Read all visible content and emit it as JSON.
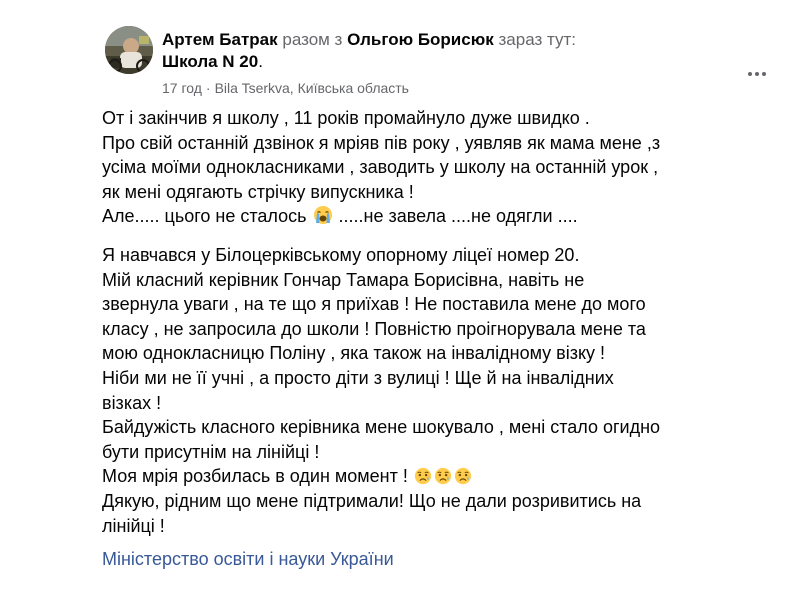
{
  "post": {
    "author": "Артем Батрак",
    "with_text": "разом з",
    "tagged_person": "Ольгою Борисюк",
    "at_text": "зараз тут:",
    "place": "Школа N 20",
    "place_suffix": ".",
    "time": "17 год",
    "location": "Bila Tserkva, Київська область",
    "paragraph_1": [
      "От і закінчив я школу , 11 років промайнуло дуже швидко .",
      "Про свій останній дзвінок я мріяв пів року , уявляв як мама мене ,з",
      "усіма моїми однокласниками , заводить у школу на останній урок ,",
      "як мені одягають стрічку випускника !"
    ],
    "paragraph_1_last_before": "Але..... цього не сталось",
    "paragraph_1_last_after": ".....не завела ....не одягли ....",
    "paragraph_2": [
      "Я навчався у Білоцерківському опорному ліцеї номер 20.",
      "Мій класний керівник Гончар Тамара Борисівна, навіть не",
      "звернула уваги , на те що я приїхав ! Не поставила мене до мого",
      "класу , не запросила до школи ! Повністю проігнорувала мене та",
      "мою однокласницю Поліну , яка також на інвалідному візку !",
      "Ніби ми не її учні , а просто діти з вулиці ! Ще й на інвалідних",
      "візках !",
      "Байдужість класного керівника мене шокувало , мені стало огидно",
      "бути присутнім на лінійці !"
    ],
    "dream_line": "Моя мрія розбилась в один момент !",
    "thanks_lines": [
      "Дякую, рідним що мене підтримали! Що не дали розривитись на",
      "лінійці !"
    ],
    "page_link": "Міністерство освіти і науки України"
  },
  "icons": {
    "crying": "loudly-crying-face-emoji",
    "sad": "sad-but-relieved-face-emoji",
    "globe": "globe-icon",
    "more": "more-options-icon"
  },
  "colors": {
    "text": "#050505",
    "muted": "#65676b",
    "link": "#385898",
    "emoji_yellow": "#ffcc4d",
    "tear_blue": "#5dadec"
  }
}
